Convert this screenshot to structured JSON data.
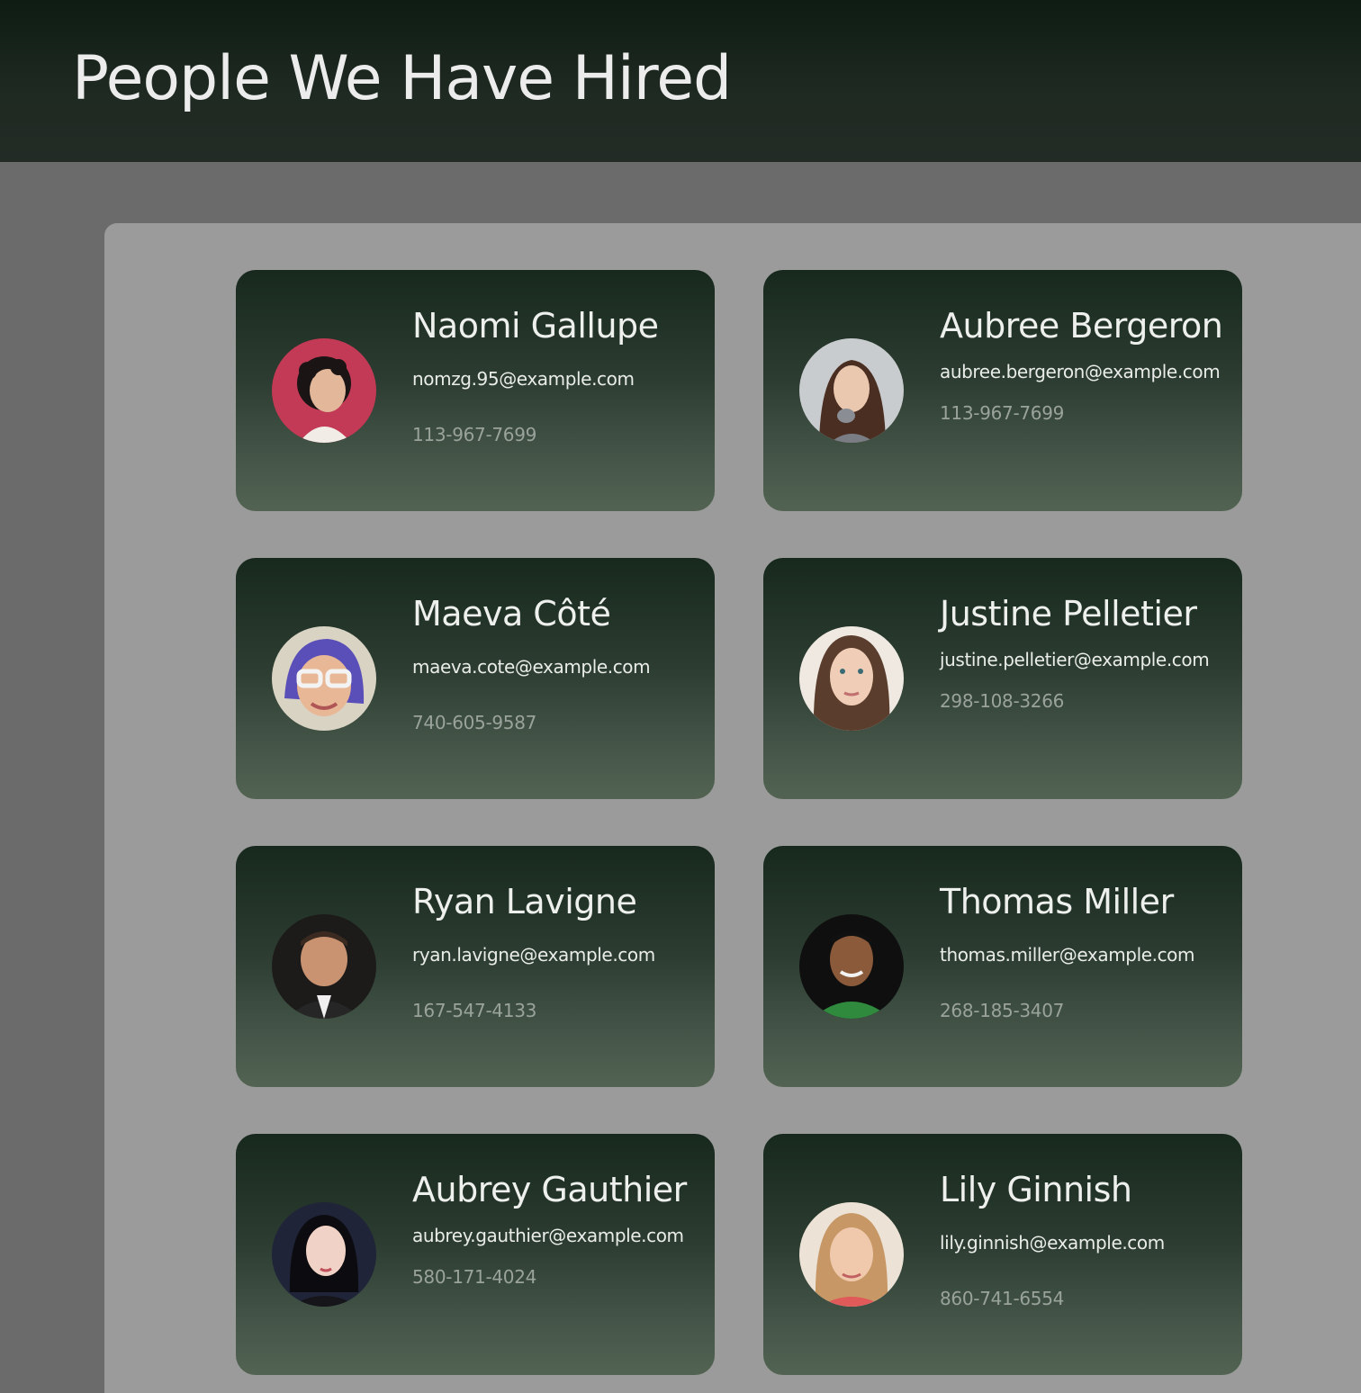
{
  "page": {
    "title": "People We Have Hired"
  },
  "people": [
    {
      "name": "Naomi Gallupe",
      "email": "nomzg.95@example.com",
      "phone": "113-967-7699",
      "avatar": "portrait-woman-curly-hair-red-background"
    },
    {
      "name": "Aubree Bergeron",
      "email": "aubree.bergeron@example.com",
      "phone": "113-967-7699",
      "avatar": "portrait-woman-surprised-grey-background"
    },
    {
      "name": "Maeva Côté",
      "email": "maeva.cote@example.com",
      "phone": "740-605-9587",
      "avatar": "portrait-woman-glasses-blue-hair"
    },
    {
      "name": "Justine Pelletier",
      "email": "justine.pelletier@example.com",
      "phone": "298-108-3266",
      "avatar": "portrait-woman-long-brown-hair"
    },
    {
      "name": "Ryan Lavigne",
      "email": "ryan.lavigne@example.com",
      "phone": "167-547-4133",
      "avatar": "portrait-man-suit-dark-background"
    },
    {
      "name": "Thomas Miller",
      "email": "thomas.miller@example.com",
      "phone": "268-185-3407",
      "avatar": "portrait-man-green-shirt"
    },
    {
      "name": "Aubrey Gauthier",
      "email": "aubrey.gauthier@example.com",
      "phone": "580-171-4024",
      "avatar": "portrait-woman-dark-hair-navy-background"
    },
    {
      "name": "Lily Ginnish",
      "email": "lily.ginnish@example.com",
      "phone": "860-741-6554",
      "avatar": "portrait-woman-blonde-hair"
    }
  ],
  "colors": {
    "header_bg": "#17241b",
    "page_bg": "#6b6b6b",
    "panel_bg": "#9b9b9b",
    "card_top": "#17281d",
    "card_bottom": "#526352"
  }
}
